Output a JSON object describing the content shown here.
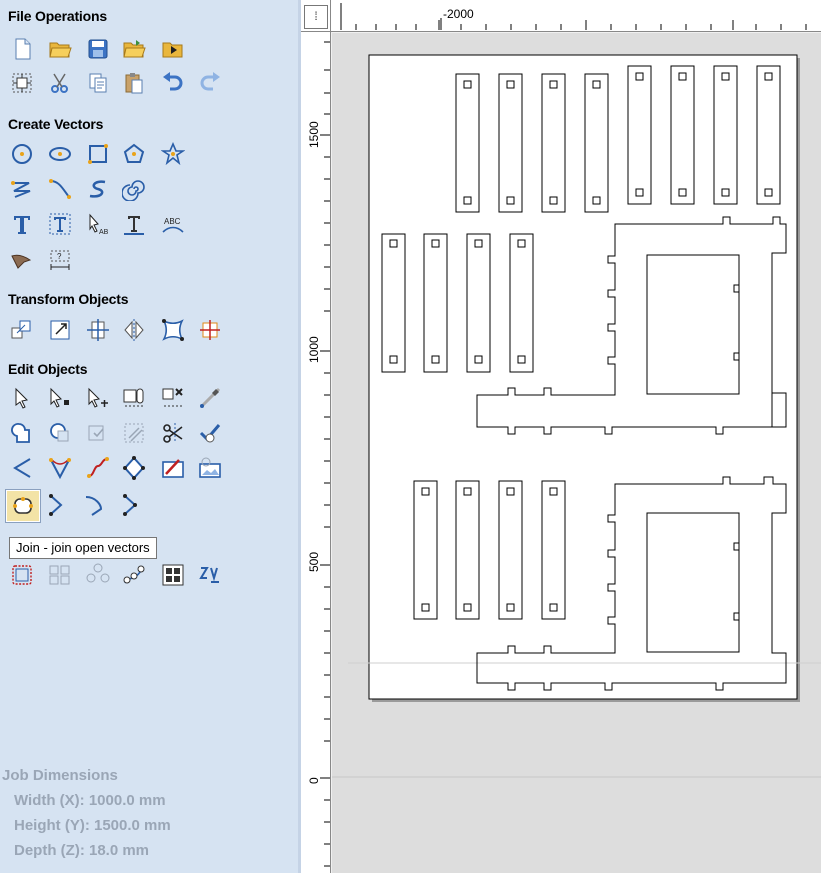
{
  "sections": {
    "file_operations": "File Operations",
    "create_vectors": "Create Vectors",
    "transform_objects": "Transform Objects",
    "edit_objects": "Edit Objects"
  },
  "tooltip": "Join - join open vectors",
  "job_dimensions": {
    "title": "Job Dimensions",
    "width": "Width  (X): 1000.0 mm",
    "height": "Height (Y): 1500.0 mm",
    "depth": "Depth  (Z): 18.0 mm"
  },
  "rulers": {
    "top_label": "-2000",
    "left_labels": [
      "1500",
      "1000",
      "500",
      "0"
    ]
  },
  "colors": {
    "panel_bg": "#d6e3f2",
    "selected_tool": "#f3e3a6",
    "dim_text": "#9aa6b6"
  }
}
